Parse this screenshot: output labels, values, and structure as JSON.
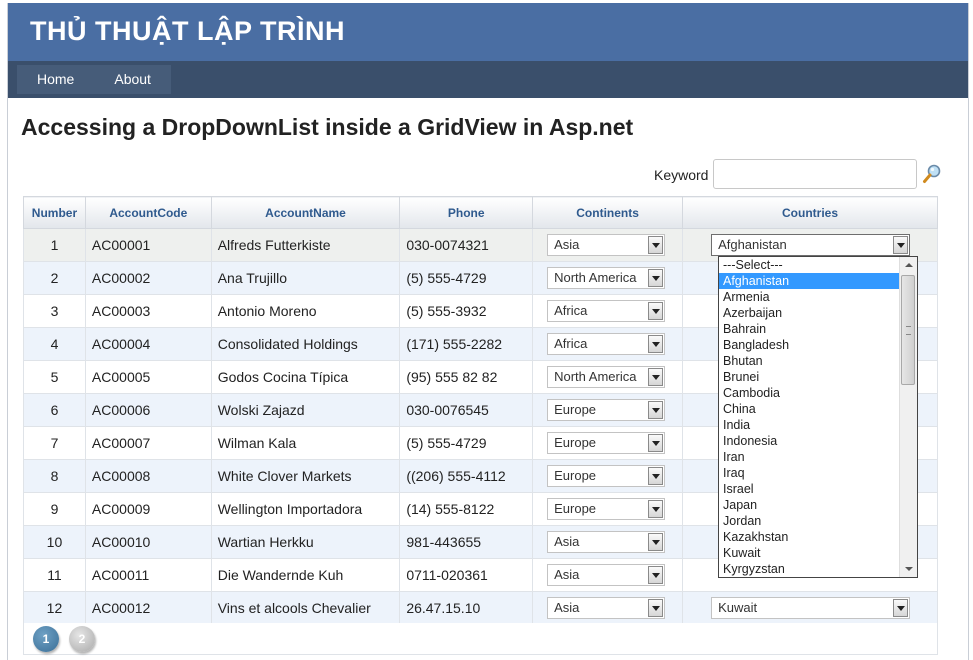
{
  "header": {
    "site_title": "THỦ THUẬT LẬP TRÌNH"
  },
  "menu": {
    "items": [
      "Home",
      "About"
    ]
  },
  "page_title": "Accessing a DropDownList inside a GridView in Asp.net",
  "search": {
    "label": "Keyword",
    "value": "",
    "icon": "magnifier-icon"
  },
  "grid": {
    "columns": [
      "Number",
      "AccountCode",
      "AccountName",
      "Phone",
      "Continents",
      "Countries"
    ],
    "rows": [
      {
        "number": "1",
        "code": "AC00001",
        "name": "Alfreds Futterkiste",
        "phone": "030-0074321",
        "continent": "Asia",
        "country": "Afghanistan"
      },
      {
        "number": "2",
        "code": "AC00002",
        "name": "Ana Trujillo",
        "phone": "(5) 555-4729",
        "continent": "North America",
        "country": ""
      },
      {
        "number": "3",
        "code": "AC00003",
        "name": "Antonio Moreno",
        "phone": "(5) 555-3932",
        "continent": "Africa",
        "country": ""
      },
      {
        "number": "4",
        "code": "AC00004",
        "name": "Consolidated Holdings",
        "phone": "(171) 555-2282",
        "continent": "Africa",
        "country": ""
      },
      {
        "number": "5",
        "code": "AC00005",
        "name": "Godos Cocina Típica",
        "phone": "(95) 555 82 82",
        "continent": "North America",
        "country": ""
      },
      {
        "number": "6",
        "code": "AC00006",
        "name": "Wolski Zajazd",
        "phone": "030-0076545",
        "continent": "Europe",
        "country": ""
      },
      {
        "number": "7",
        "code": "AC00007",
        "name": "Wilman Kala",
        "phone": "(5) 555-4729",
        "continent": "Europe",
        "country": ""
      },
      {
        "number": "8",
        "code": "AC00008",
        "name": "White Clover Markets",
        "phone": "((206) 555-4112",
        "continent": "Europe",
        "country": ""
      },
      {
        "number": "9",
        "code": "AC00009",
        "name": "Wellington Importadora",
        "phone": "(14) 555-8122",
        "continent": "Europe",
        "country": ""
      },
      {
        "number": "10",
        "code": "AC00010",
        "name": "Wartian Herkku",
        "phone": "981-443655",
        "continent": "Asia",
        "country": ""
      },
      {
        "number": "11",
        "code": "AC00011",
        "name": "Die Wandernde Kuh",
        "phone": "0711-020361",
        "continent": "Asia",
        "country": ""
      },
      {
        "number": "12",
        "code": "AC00012",
        "name": "Vins et alcools Chevalier",
        "phone": "26.47.15.10",
        "continent": "Asia",
        "country": "Kuwait"
      }
    ]
  },
  "country_dropdown": {
    "options": [
      "---Select---",
      "Afghanistan",
      "Armenia",
      "Azerbaijan",
      "Bahrain",
      "Bangladesh",
      "Bhutan",
      "Brunei",
      "Cambodia",
      "China",
      "India",
      "Indonesia",
      "Iran",
      "Iraq",
      "Israel",
      "Japan",
      "Jordan",
      "Kazakhstan",
      "Kuwait",
      "Kyrgyzstan"
    ],
    "highlighted": "Afghanistan"
  },
  "pager": {
    "pages": [
      "1",
      "2"
    ],
    "current": "1"
  },
  "colors": {
    "header_bg": "#4a6ea3",
    "nav_bg": "#3a4f6b",
    "column_header_text": "#2f5a8e",
    "alt_row": "#edf3fb",
    "highlight": "#3399ff"
  }
}
